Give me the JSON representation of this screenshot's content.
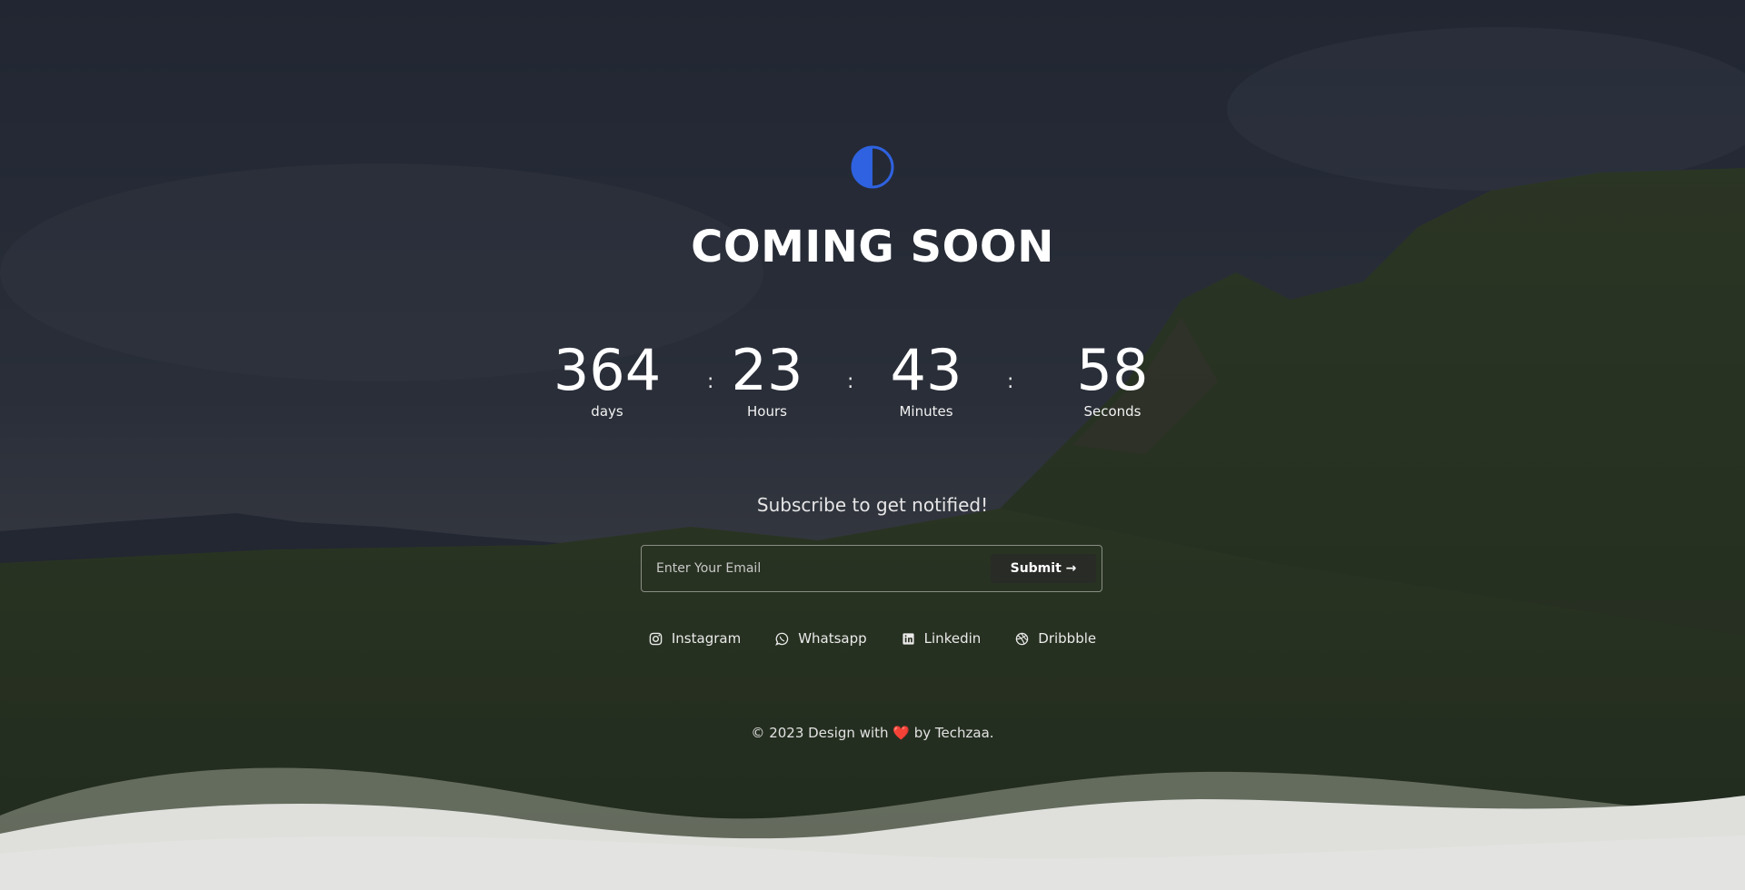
{
  "title": "COMING SOON",
  "countdown": {
    "days": {
      "value": "364",
      "label": "days"
    },
    "hours": {
      "value": "23",
      "label": "Hours"
    },
    "minutes": {
      "value": "43",
      "label": "Minutes"
    },
    "seconds": {
      "value": "58",
      "label": "Seconds"
    },
    "separator": ":"
  },
  "subscribe": {
    "heading": "Subscribe to get notified!",
    "email_placeholder": "Enter Your Email",
    "submit_label": "Submit →"
  },
  "socials": [
    {
      "label": "Instagram",
      "icon": "instagram-icon"
    },
    {
      "label": "Whatsapp",
      "icon": "whatsapp-icon"
    },
    {
      "label": "Linkedin",
      "icon": "linkedin-icon"
    },
    {
      "label": "Dribbble",
      "icon": "dribbble-icon"
    }
  ],
  "footer": {
    "prefix": "© 2023 Design with",
    "heart": "❤️",
    "suffix": "by Techzaa."
  },
  "colors": {
    "accent": "#2f62e0",
    "overlay": "#161822",
    "wave": "#e3e4e1"
  }
}
